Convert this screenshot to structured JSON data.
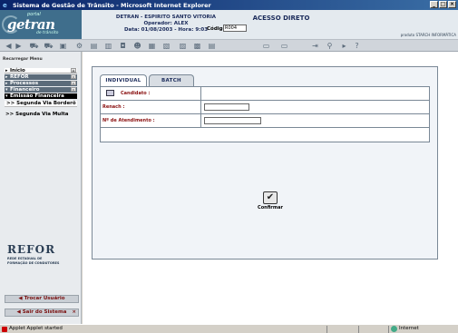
{
  "window": {
    "title": "Sistema de Gestão de Trânsito - Microsoft Internet Explorer"
  },
  "logo": {
    "portal": "portal",
    "brand": "getran",
    "tagline": "de trânsito"
  },
  "header": {
    "org": "DETRAN - ESPIRITO SANTO VITORIA",
    "operator": "Operador: ALEX",
    "datetime": "Data: 01/08/2003 - Hora: 9:03",
    "section": "ACESSO DIRETO",
    "codigo_label": "Código:",
    "codigo_value": "R004",
    "produto": "produto STARCH INFORMÁTICA"
  },
  "toolbar": {
    "icons": [
      "arrow-left-icon",
      "arrow-right-icon",
      "car-icon",
      "truck-icon",
      "bus-icon",
      "motorcycle-icon",
      "car-front-icon",
      "traffic-icon",
      "vehicle-icon",
      "person-icon",
      "document-icon",
      "license-icon",
      "fine-icon",
      "money-icon",
      "chart-icon",
      "calc-icon",
      "print-icon",
      "help-icon"
    ]
  },
  "sidebar": {
    "recarregar": "Recarregar Menu",
    "items": [
      {
        "label": "Início"
      },
      {
        "label": "REFOR"
      },
      {
        "label": "Processos"
      },
      {
        "label": "Financeiro"
      },
      {
        "label": "Emissão Financeira"
      }
    ],
    "subitems": [
      {
        "label": ">> Segunda Via Borderô"
      },
      {
        "label": ">> Segunda Via Multa"
      }
    ],
    "refor_logo": "REFOR",
    "refor_desc1": "REDE ESTADUAL DE",
    "refor_desc2": "FORMAÇÃO DE CONDUTORES",
    "trocar": "Trocar Usuário",
    "sair": "Sair do Sistema"
  },
  "content": {
    "tabs": [
      {
        "label": "INDIVIDUAL"
      },
      {
        "label": "BATCH"
      }
    ],
    "candidato_label": "Candidato :",
    "renach_label": "Renach :",
    "atendimento_label": "Nº de Atendimento :",
    "renach_value": "",
    "atendimento_value": "",
    "confirmar": "Confirmar"
  },
  "statusbar": {
    "text": "Applet Applet started",
    "zone": "Internet"
  }
}
